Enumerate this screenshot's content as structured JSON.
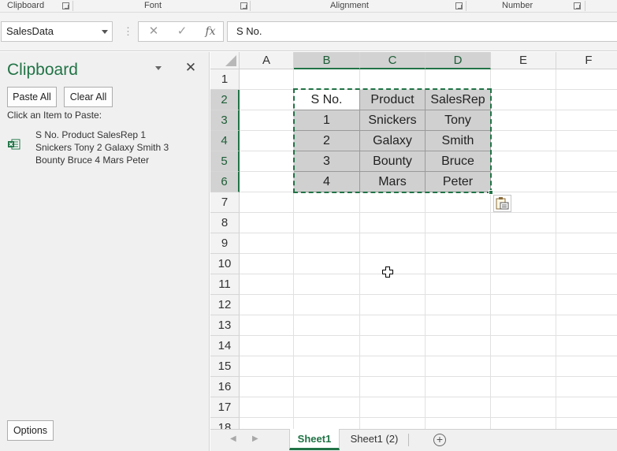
{
  "ribbon_groups": [
    {
      "label": "Clipboard"
    },
    {
      "label": "Font"
    },
    {
      "label": "Alignment"
    },
    {
      "label": "Number"
    }
  ],
  "name_box": {
    "value": "SalesData"
  },
  "formula_bar": {
    "separator": "⋮",
    "cancel": "✕",
    "enter": "✓",
    "fx": "fx",
    "value": "S No."
  },
  "clipboard_pane": {
    "title": "Clipboard",
    "close": "✕",
    "paste_all": "Paste All",
    "clear_all": "Clear All",
    "instruction": "Click an Item to Paste:",
    "items": [
      {
        "text": "S No. Product SalesRep 1 Snickers Tony 2 Galaxy Smith 3 Bounty Bruce 4 Mars Peter",
        "icon": "excel-icon"
      }
    ],
    "options": "Options"
  },
  "grid": {
    "columns": [
      "A",
      "B",
      "C",
      "D",
      "E",
      "F"
    ],
    "selected_columns": [
      "B",
      "C",
      "D"
    ],
    "rows": [
      "1",
      "2",
      "3",
      "4",
      "5",
      "6",
      "7",
      "8",
      "9",
      "10",
      "11",
      "12",
      "13",
      "14",
      "15",
      "16",
      "17",
      "18"
    ],
    "selected_rows": [
      "2",
      "3",
      "4",
      "5",
      "6"
    ],
    "table": {
      "headers": [
        "S No.",
        "Product",
        "SalesRep"
      ],
      "rows": [
        [
          "1",
          "Snickers",
          "Tony"
        ],
        [
          "2",
          "Galaxy",
          "Smith"
        ],
        [
          "3",
          "Bounty",
          "Bruce"
        ],
        [
          "4",
          "Mars",
          "Peter"
        ]
      ]
    }
  },
  "tabs": [
    {
      "label": "Sheet1",
      "active": true
    },
    {
      "label": "Sheet1 (2)",
      "active": false
    }
  ],
  "add_sheet": "+",
  "colors": {
    "accent": "#217346",
    "selection_fill": "#d0d0d0"
  }
}
